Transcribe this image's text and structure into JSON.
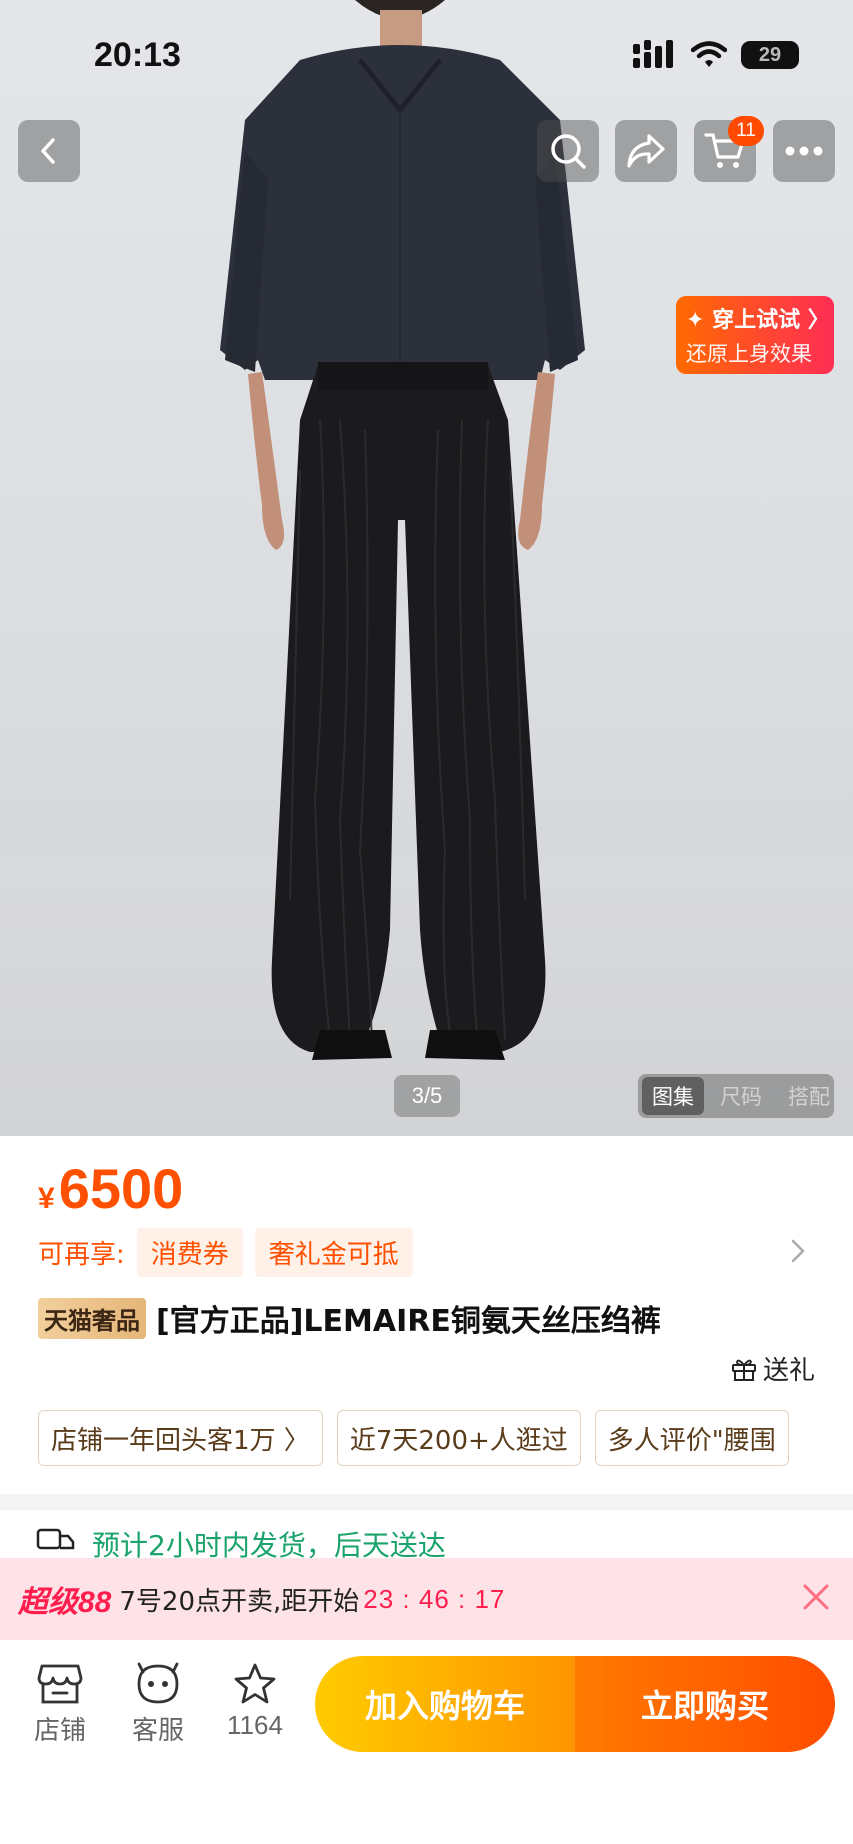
{
  "status_bar": {
    "time": "20:13",
    "battery": "29"
  },
  "nav": {
    "cart_count": "11"
  },
  "tryon": {
    "line1": "✦ 穿上试试 〉",
    "line2": "还原上身效果"
  },
  "gallery": {
    "pager": "3/5",
    "tabs": [
      "图集",
      "尺码",
      "搭配"
    ]
  },
  "product": {
    "currency": "¥",
    "price": "6500",
    "perks_label": "可再享:",
    "perks": [
      "消费券",
      "奢礼金可抵"
    ],
    "store_badge": "天猫奢品",
    "title": "[官方正品]LEMAIRE铜氨天丝压绉裤",
    "gift_label": "送礼",
    "chips": [
      "店铺一年回头客1万 〉",
      "近7天200+人逛过",
      "多人评价\"腰围"
    ],
    "shipping": "预计2小时内发货，后天送达"
  },
  "promo": {
    "logo": "超级88",
    "text": "7号20点开卖,距开始",
    "countdown": "23 : 46 : 17"
  },
  "bottom_bar": {
    "store_label": "店铺",
    "service_label": "客服",
    "favorites_count": "1164",
    "add_to_cart": "加入购物车",
    "buy_now": "立即购买"
  },
  "colors": {
    "accent": "#ff5000",
    "promo_red": "#ff1e4d",
    "shipping_green": "#1aa36a"
  }
}
